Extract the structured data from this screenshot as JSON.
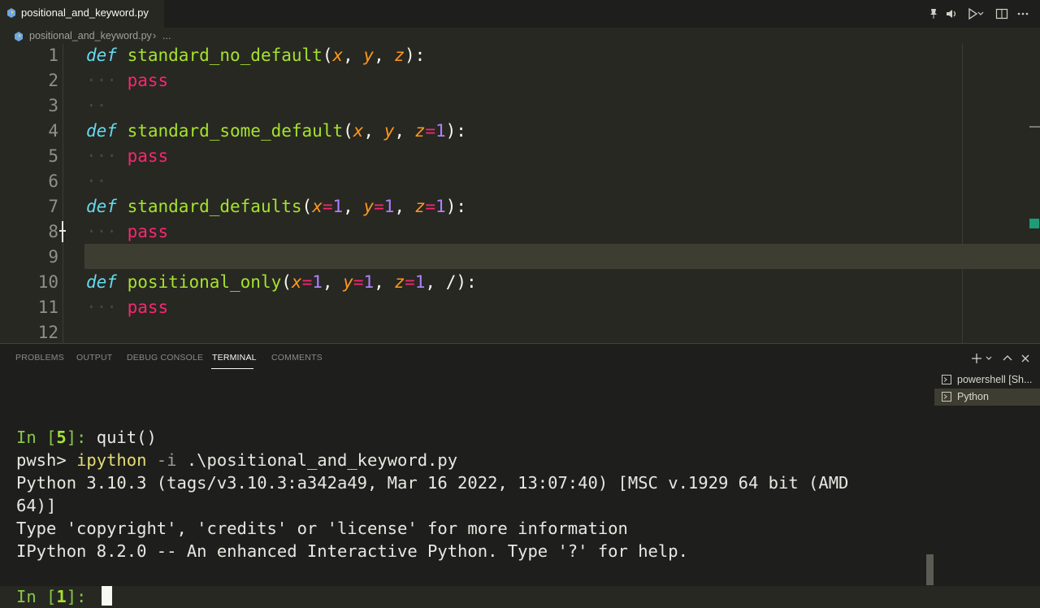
{
  "tab": {
    "filename": "positional_and_keyword.py"
  },
  "breadcrumb": {
    "file": "positional_and_keyword.py",
    "sep": "›",
    "ellipsis": "..."
  },
  "editor": {
    "line_numbers": [
      "1",
      "2",
      "3",
      "4",
      "5",
      "6",
      "7",
      "8",
      "9",
      "10",
      "11",
      "12"
    ],
    "lines": [
      [
        [
          "kw",
          "def"
        ],
        [
          "txt",
          " "
        ],
        [
          "fn",
          "standard_no_default"
        ],
        [
          "txt",
          "("
        ],
        [
          "prm",
          "x"
        ],
        [
          "txt",
          ", "
        ],
        [
          "prm",
          "y"
        ],
        [
          "txt",
          ", "
        ],
        [
          "prm",
          "z"
        ],
        [
          "txt",
          "):"
        ]
      ],
      [
        [
          "ws",
          "···"
        ],
        [
          "txt",
          " "
        ],
        [
          "pass",
          "pass"
        ]
      ],
      [
        [
          "ws",
          "··"
        ]
      ],
      [
        [
          "kw",
          "def"
        ],
        [
          "txt",
          " "
        ],
        [
          "fn",
          "standard_some_default"
        ],
        [
          "txt",
          "("
        ],
        [
          "prm",
          "x"
        ],
        [
          "txt",
          ", "
        ],
        [
          "prm",
          "y"
        ],
        [
          "txt",
          ", "
        ],
        [
          "prm",
          "z"
        ],
        [
          "op",
          "="
        ],
        [
          "num",
          "1"
        ],
        [
          "txt",
          "):"
        ]
      ],
      [
        [
          "ws",
          "···"
        ],
        [
          "txt",
          " "
        ],
        [
          "pass",
          "pass"
        ]
      ],
      [
        [
          "ws",
          "··"
        ]
      ],
      [
        [
          "kw",
          "def"
        ],
        [
          "txt",
          " "
        ],
        [
          "fn",
          "standard_defaults"
        ],
        [
          "txt",
          "("
        ],
        [
          "prm",
          "x"
        ],
        [
          "op",
          "="
        ],
        [
          "num",
          "1"
        ],
        [
          "txt",
          ", "
        ],
        [
          "prm",
          "y"
        ],
        [
          "op",
          "="
        ],
        [
          "num",
          "1"
        ],
        [
          "txt",
          ", "
        ],
        [
          "prm",
          "z"
        ],
        [
          "op",
          "="
        ],
        [
          "num",
          "1"
        ],
        [
          "txt",
          "):"
        ]
      ],
      [
        [
          "ws",
          "···"
        ],
        [
          "txt",
          " "
        ],
        [
          "pass",
          "pass"
        ]
      ],
      [],
      [
        [
          "kw",
          "def"
        ],
        [
          "txt",
          " "
        ],
        [
          "fn",
          "positional_only"
        ],
        [
          "txt",
          "("
        ],
        [
          "prm",
          "x"
        ],
        [
          "op",
          "="
        ],
        [
          "num",
          "1"
        ],
        [
          "txt",
          ", "
        ],
        [
          "prm",
          "y"
        ],
        [
          "op",
          "="
        ],
        [
          "num",
          "1"
        ],
        [
          "txt",
          ", "
        ],
        [
          "prm",
          "z"
        ],
        [
          "op",
          "="
        ],
        [
          "num",
          "1"
        ],
        [
          "txt",
          ", /):"
        ]
      ],
      [
        [
          "ws",
          "···"
        ],
        [
          "txt",
          " "
        ],
        [
          "pass",
          "pass"
        ]
      ],
      []
    ]
  },
  "panel": {
    "tabs": [
      "PROBLEMS",
      "OUTPUT",
      "DEBUG CONSOLE",
      "TERMINAL",
      "COMMENTS"
    ],
    "active_tab": "TERMINAL"
  },
  "terminal": {
    "lines": [
      [],
      [
        [
          "tg",
          "In ["
        ],
        [
          "tgb",
          "5"
        ],
        [
          "tg",
          "]: "
        ],
        [
          "txt",
          "quit()"
        ]
      ],
      [
        [
          "txt",
          "pwsh> "
        ],
        [
          "ty",
          "ipython"
        ],
        [
          "tdim",
          " -i"
        ],
        [
          "txt",
          " .\\positional_and_keyword.py"
        ]
      ],
      [
        [
          "txt",
          "Python 3.10.3 (tags/v3.10.3:a342a49, Mar 16 2022, 13:07:40) [MSC v.1929 64 bit (AMD"
        ]
      ],
      [
        [
          "txt",
          "64)]"
        ]
      ],
      [
        [
          "txt",
          "Type 'copyright', 'credits' or 'license' for more information"
        ]
      ],
      [
        [
          "txt",
          "IPython 8.2.0 -- An enhanced Interactive Python. Type '?' for help."
        ]
      ],
      [],
      [
        [
          "tg",
          "In ["
        ],
        [
          "tgb",
          "1"
        ],
        [
          "tg",
          "]: "
        ]
      ]
    ]
  },
  "terminal_list": [
    {
      "label": "powershell [Sh..."
    },
    {
      "label": "Python"
    }
  ]
}
